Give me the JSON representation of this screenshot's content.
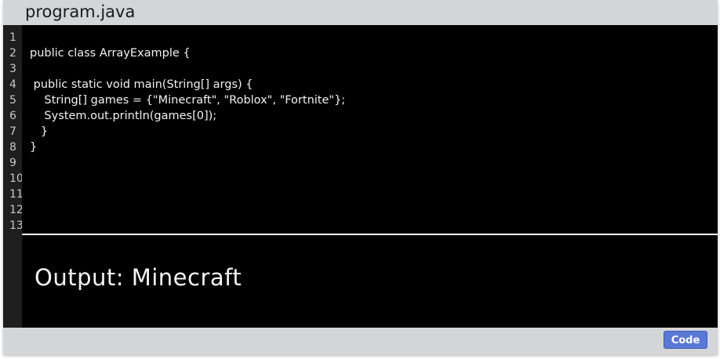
{
  "window": {
    "title": "program.java"
  },
  "editor": {
    "line_numbers": [
      "1",
      "2",
      "3",
      "4",
      "5",
      "6",
      "7",
      "8",
      "9",
      "10",
      "11",
      "12",
      "13"
    ],
    "lines": [
      "",
      "public class ArrayExample {",
      "",
      " public static void main(String[] args) {",
      "    String[] games = {\"Minecraft\", \"Roblox\", \"Fortnite\"};",
      "    System.out.println(games[0]);",
      "   }",
      "}",
      "",
      "",
      "",
      "",
      ""
    ]
  },
  "output": {
    "text": "Output: Minecraft"
  },
  "toolbar": {
    "code_label": "Code"
  },
  "colors": {
    "editor_background": "#000000",
    "window_chrome": "#d4d5d7",
    "button_accent": "#5a78d6",
    "text": "#f2f2f2"
  }
}
